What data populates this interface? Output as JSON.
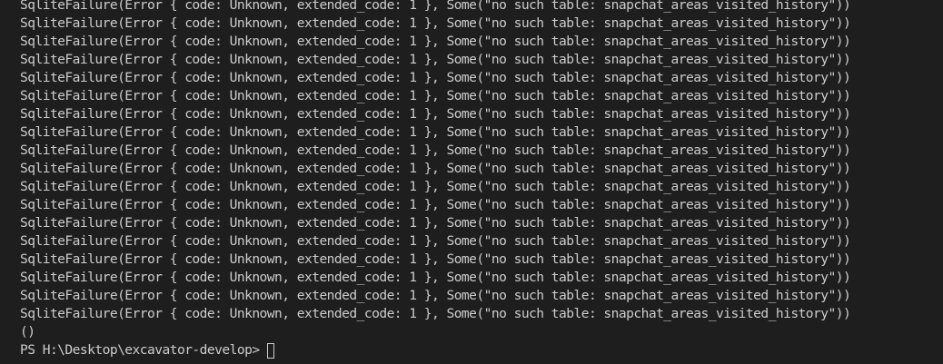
{
  "terminal": {
    "error_lines": [
      "SqliteFailure(Error { code: Unknown, extended_code: 1 }, Some(\"no such table: snapchat_areas_visited_history\"))",
      "SqliteFailure(Error { code: Unknown, extended_code: 1 }, Some(\"no such table: snapchat_areas_visited_history\"))",
      "SqliteFailure(Error { code: Unknown, extended_code: 1 }, Some(\"no such table: snapchat_areas_visited_history\"))",
      "SqliteFailure(Error { code: Unknown, extended_code: 1 }, Some(\"no such table: snapchat_areas_visited_history\"))",
      "SqliteFailure(Error { code: Unknown, extended_code: 1 }, Some(\"no such table: snapchat_areas_visited_history\"))",
      "SqliteFailure(Error { code: Unknown, extended_code: 1 }, Some(\"no such table: snapchat_areas_visited_history\"))",
      "SqliteFailure(Error { code: Unknown, extended_code: 1 }, Some(\"no such table: snapchat_areas_visited_history\"))",
      "SqliteFailure(Error { code: Unknown, extended_code: 1 }, Some(\"no such table: snapchat_areas_visited_history\"))",
      "SqliteFailure(Error { code: Unknown, extended_code: 1 }, Some(\"no such table: snapchat_areas_visited_history\"))",
      "SqliteFailure(Error { code: Unknown, extended_code: 1 }, Some(\"no such table: snapchat_areas_visited_history\"))",
      "SqliteFailure(Error { code: Unknown, extended_code: 1 }, Some(\"no such table: snapchat_areas_visited_history\"))",
      "SqliteFailure(Error { code: Unknown, extended_code: 1 }, Some(\"no such table: snapchat_areas_visited_history\"))",
      "SqliteFailure(Error { code: Unknown, extended_code: 1 }, Some(\"no such table: snapchat_areas_visited_history\"))",
      "SqliteFailure(Error { code: Unknown, extended_code: 1 }, Some(\"no such table: snapchat_areas_visited_history\"))",
      "SqliteFailure(Error { code: Unknown, extended_code: 1 }, Some(\"no such table: snapchat_areas_visited_history\"))",
      "SqliteFailure(Error { code: Unknown, extended_code: 1 }, Some(\"no such table: snapchat_areas_visited_history\"))",
      "SqliteFailure(Error { code: Unknown, extended_code: 1 }, Some(\"no such table: snapchat_areas_visited_history\"))",
      "SqliteFailure(Error { code: Unknown, extended_code: 1 }, Some(\"no such table: snapchat_areas_visited_history\"))"
    ],
    "unit_output": "()",
    "prompt": "PS H:\\Desktop\\excavator-develop>",
    "colors": {
      "background": "#1e1e1e",
      "foreground": "#cccccc"
    }
  }
}
